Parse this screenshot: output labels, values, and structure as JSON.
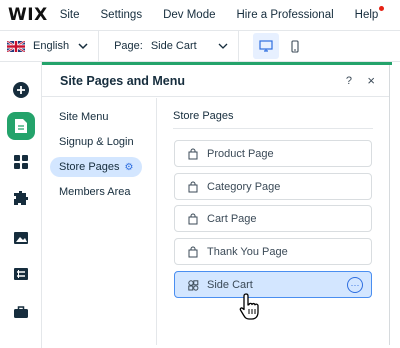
{
  "topbar": {
    "logo": "WIX",
    "menu": [
      "Site",
      "Settings",
      "Dev Mode",
      "Hire a Professional",
      "Help"
    ]
  },
  "bar2": {
    "language": "English",
    "page_label": "Page:",
    "page_value": "Side Cart"
  },
  "panel": {
    "title": "Site Pages and Menu",
    "help": "?",
    "close": "×",
    "nav": [
      {
        "label": "Site Menu"
      },
      {
        "label": "Signup & Login"
      },
      {
        "label": "Store Pages"
      },
      {
        "label": "Members Area"
      }
    ],
    "section_title": "Store Pages",
    "pages": [
      {
        "label": "Product Page",
        "icon": "shopping-bag-icon"
      },
      {
        "label": "Category Page",
        "icon": "shopping-bag-icon"
      },
      {
        "label": "Cart Page",
        "icon": "shopping-bag-icon"
      },
      {
        "label": "Thank You Page",
        "icon": "shopping-bag-icon"
      },
      {
        "label": "Side Cart",
        "icon": "cart-widget-icon"
      }
    ],
    "more": "···"
  },
  "colors": {
    "accent_green": "#24a36b",
    "selected_blue": "#d3e6ff",
    "accent_blue": "#2f6fe0"
  }
}
